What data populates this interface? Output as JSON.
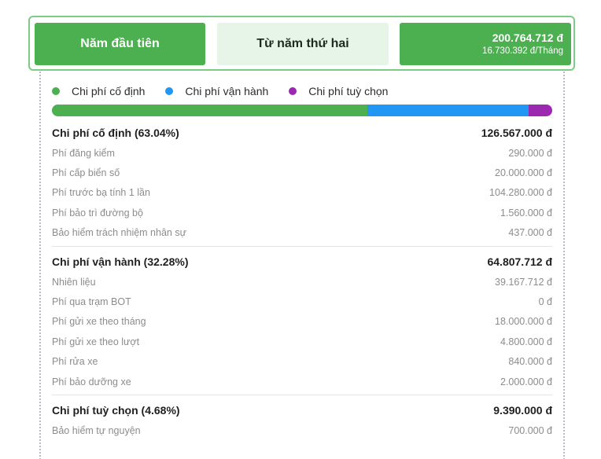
{
  "tabs": {
    "first_year": "Năm đầu tiên",
    "second_year": "Từ năm thứ hai",
    "total_amount": "200.764.712 đ",
    "monthly_amount": "16.730.392 đ/Tháng"
  },
  "colors": {
    "fixed": "#4caf50",
    "operating": "#2196f3",
    "optional": "#9c27b0"
  },
  "legend": {
    "fixed": "Chi phí cố định",
    "operating": "Chi phí vận hành",
    "optional": "Chi phí tuỳ chọn"
  },
  "breakdown_percent": {
    "fixed": 63.04,
    "operating": 32.28,
    "optional": 4.68
  },
  "groups": {
    "fixed": {
      "title": "Chi phí cố định (63.04%)",
      "total": "126.567.000 đ",
      "items": [
        {
          "label": "Phí đăng kiểm",
          "value": "290.000 đ"
        },
        {
          "label": "Phí cấp biển số",
          "value": "20.000.000 đ"
        },
        {
          "label": "Phí trước bạ tính 1 lần",
          "value": "104.280.000 đ"
        },
        {
          "label": "Phí bảo trì đường bộ",
          "value": "1.560.000 đ"
        },
        {
          "label": "Bảo hiểm trách nhiệm nhân sự",
          "value": "437.000 đ"
        }
      ]
    },
    "operating": {
      "title": "Chi phí vận hành (32.28%)",
      "total": "64.807.712 đ",
      "items": [
        {
          "label": "Nhiên liệu",
          "value": "39.167.712 đ"
        },
        {
          "label": "Phí qua trạm BOT",
          "value": "0 đ"
        },
        {
          "label": "Phí gửi xe theo tháng",
          "value": "18.000.000 đ"
        },
        {
          "label": "Phí gửi xe theo lượt",
          "value": "4.800.000 đ"
        },
        {
          "label": "Phí rửa xe",
          "value": "840.000 đ"
        },
        {
          "label": "Phí bảo dưỡng xe",
          "value": "2.000.000 đ"
        }
      ]
    },
    "optional": {
      "title": "Chi phí tuỳ chọn (4.68%)",
      "total": "9.390.000 đ",
      "items": [
        {
          "label": "Bảo hiểm tự nguyện",
          "value": "700.000 đ"
        }
      ]
    }
  }
}
